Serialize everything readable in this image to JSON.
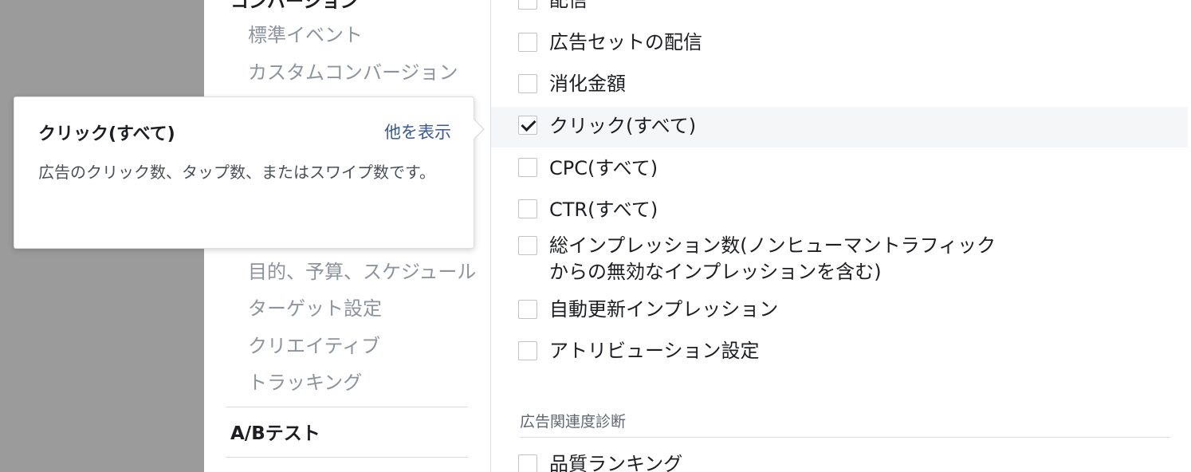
{
  "left_nav": {
    "section_conversion": "コンバージョン",
    "conversion_items": [
      "標準イベント",
      "カスタムコンバージョン"
    ],
    "setting_items": [
      "目的、予算、スケジュール",
      "ターゲット設定",
      "クリエイティブ",
      "トラッキング"
    ],
    "section_ab_test": "A/Bテスト"
  },
  "metrics": [
    {
      "label": "配信",
      "checked": false
    },
    {
      "label": "広告セットの配信",
      "checked": false
    },
    {
      "label": "消化金額",
      "checked": false
    },
    {
      "label": "クリック(すべて)",
      "checked": true
    },
    {
      "label": "CPC(すべて)",
      "checked": false
    },
    {
      "label": "CTR(すべて)",
      "checked": false
    },
    {
      "label_line1": "総インプレッション数(ノンヒューマントラフィック",
      "label_line2": "からの無効なインプレッションを含む)",
      "checked": false
    },
    {
      "label": "自動更新インプレッション",
      "checked": false
    },
    {
      "label": "アトリビューション設定",
      "checked": false
    }
  ],
  "relevance_section": {
    "header": "広告関連度診断",
    "items": [
      {
        "label": "品質ランキング",
        "checked": false
      }
    ]
  },
  "tooltip": {
    "title": "クリック(すべて)",
    "more_link": "他を表示",
    "description": "広告のクリック数、タップ数、またはスワイプ数です。"
  },
  "colors": {
    "overlay": "#9b9b9b",
    "link": "#385898",
    "muted_text": "#8d949e",
    "highlight_row": "#f5f6f7"
  }
}
